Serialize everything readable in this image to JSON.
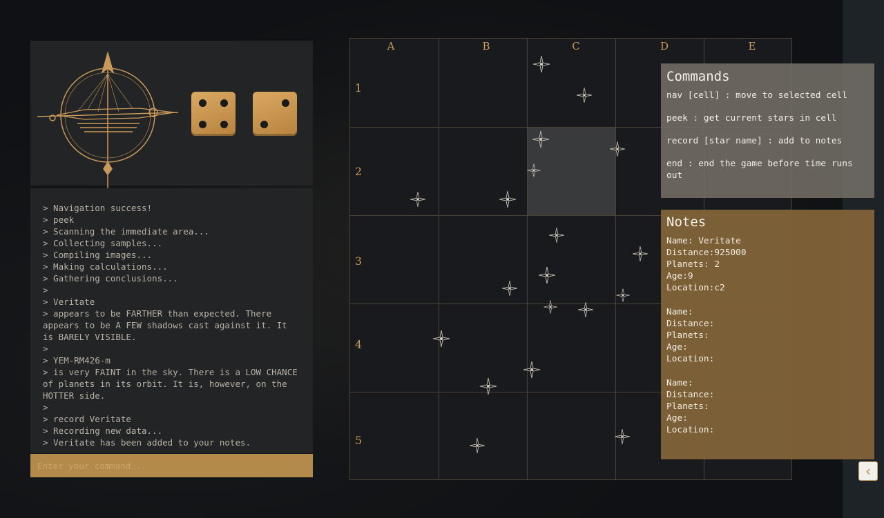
{
  "log": {
    "lines": [
      "> Navigation success!",
      "> peek",
      "> Scanning the immediate area...",
      "> Collecting samples...",
      "> Compiling images...",
      "> Making calculations...",
      "> Gathering conclusions...",
      ">",
      "> Veritate",
      "> appears to be FARTHER than expected. There appears to be A FEW shadows cast against it. It is BARELY VISIBLE.",
      ">",
      "> YEM-RM426-m",
      "> is very FAINT in the sky. There is a LOW CHANCE of planets in its orbit. It is, however, on the HOTTER side.",
      ">",
      "> record Veritate",
      "> Recording new data...",
      "> Veritate has been added to your notes."
    ]
  },
  "input": {
    "placeholder": "Enter your command..."
  },
  "dice": [
    4,
    2
  ],
  "grid": {
    "columns": [
      "A",
      "B",
      "C",
      "D",
      "E"
    ],
    "rows": [
      "1",
      "2",
      "3",
      "4",
      "5"
    ],
    "selected_cell": "C2"
  },
  "commands": {
    "title": "Commands",
    "items": [
      "nav [cell] : move to selected cell",
      "peek : get current stars in cell",
      "record [star name] : add to notes",
      "end : end the game before time runs out"
    ]
  },
  "notes": {
    "title": "Notes",
    "entries": [
      {
        "name": "Name: Veritate",
        "distance": "Distance:925000",
        "planets": "Planets: 2",
        "age": "Age:9",
        "location": "Location:c2"
      },
      {
        "name": "Name:",
        "distance": "Distance:",
        "planets": "Planets:",
        "age": "Age:",
        "location": "Location:"
      },
      {
        "name": "Name:",
        "distance": "Distance:",
        "planets": "Planets:",
        "age": "Age:",
        "location": "Location:"
      }
    ]
  },
  "colors": {
    "accent": "#b48a4a",
    "panel": "#232426",
    "notes": "#846539",
    "commands": "#736e66"
  },
  "icons": {
    "collapse": "chevron-left-icon",
    "emblem": "compass-emblem-icon",
    "star": "four-point-star-icon"
  }
}
